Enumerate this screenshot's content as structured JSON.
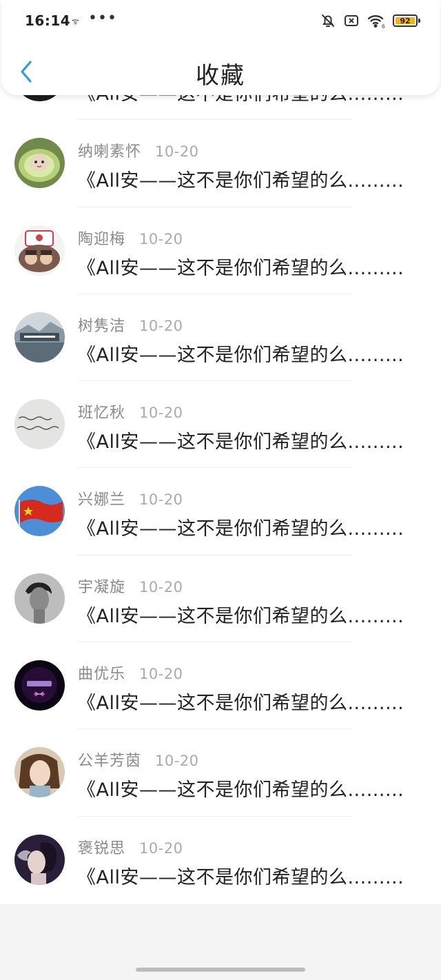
{
  "status_bar": {
    "time": "16:14",
    "small_icon_text": "ᯤ",
    "dots": "•••",
    "battery_level": "92",
    "icons": [
      "bell-off-icon",
      "sim-x-icon",
      "wifi-icon",
      "battery-icon"
    ]
  },
  "header": {
    "title": "收藏",
    "back_icon": "chevron-left-icon",
    "accent_color": "#2f9bde"
  },
  "list": {
    "items": [
      {
        "name": "",
        "date": "",
        "title": "《All安——这不是你们希望的么.........",
        "avatar": "dark-avatar"
      },
      {
        "name": "纳喇素怀",
        "date": "10-20",
        "title": "《All安——这不是你们希望的么.........",
        "avatar": "cat-melon-avatar"
      },
      {
        "name": "陶迎梅",
        "date": "10-20",
        "title": "《All安——这不是你们希望的么.........",
        "avatar": "cake-dolls-avatar"
      },
      {
        "name": "树隽洁",
        "date": "10-20",
        "title": "《All安——这不是你们希望的么.........",
        "avatar": "landscape-text-avatar"
      },
      {
        "name": "班忆秋",
        "date": "10-20",
        "title": "《All安——这不是你们希望的么.........",
        "avatar": "handwriting-avatar"
      },
      {
        "name": "兴娜兰",
        "date": "10-20",
        "title": "《All安——这不是你们希望的么.........",
        "avatar": "flag-avatar"
      },
      {
        "name": "宇凝旋",
        "date": "10-20",
        "title": "《All安——这不是你们希望的么.........",
        "avatar": "man-portrait-avatar"
      },
      {
        "name": "曲优乐",
        "date": "10-20",
        "title": "《All安——这不是你们希望的么.........",
        "avatar": "pisces-avatar"
      },
      {
        "name": "公羊芳茵",
        "date": "10-20",
        "title": "《All安——这不是你们希望的么.........",
        "avatar": "woman-photo-avatar"
      },
      {
        "name": "褒锐思",
        "date": "10-20",
        "title": "《All安——这不是你们希望的么.........",
        "avatar": "smoke-portrait-avatar"
      }
    ]
  }
}
